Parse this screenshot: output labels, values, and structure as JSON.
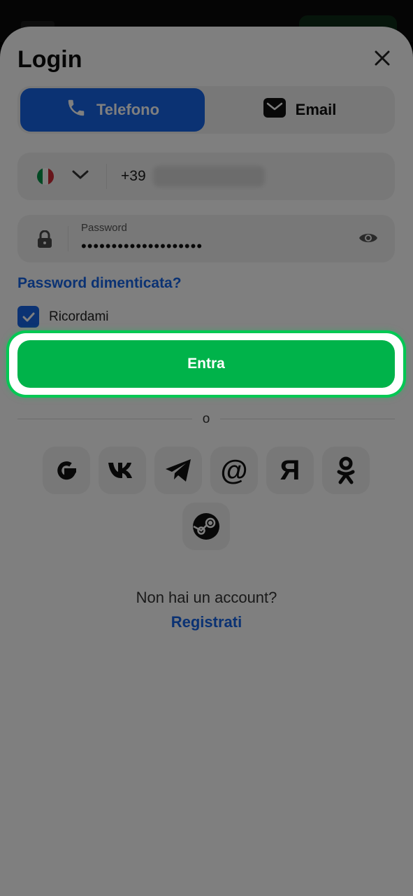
{
  "dialog": {
    "title": "Login",
    "tabs": [
      {
        "label": "Telefono",
        "icon": "phone-icon",
        "active": true
      },
      {
        "label": "Email",
        "icon": "envelope-icon",
        "active": false
      }
    ],
    "phone": {
      "country_flag": "it-flag-icon",
      "prefix": "+39"
    },
    "password": {
      "label": "Password",
      "value": "••••••••••••••••••••"
    },
    "forgot_link": "Password dimenticata?",
    "remember": {
      "label": "Ricordami",
      "checked": true
    },
    "submit_label": "Entra",
    "divider_text": "o",
    "social": [
      "google-icon",
      "vk-icon",
      "telegram-icon",
      "mail-ru-icon",
      "yandex-icon",
      "odnoklassniki-icon",
      "steam-icon"
    ],
    "no_account_text": "Non hai un account?",
    "register_link": "Registrati"
  },
  "colors": {
    "primary": "#1765e6",
    "success": "#00b34a",
    "field_bg": "#f1f1f1"
  }
}
